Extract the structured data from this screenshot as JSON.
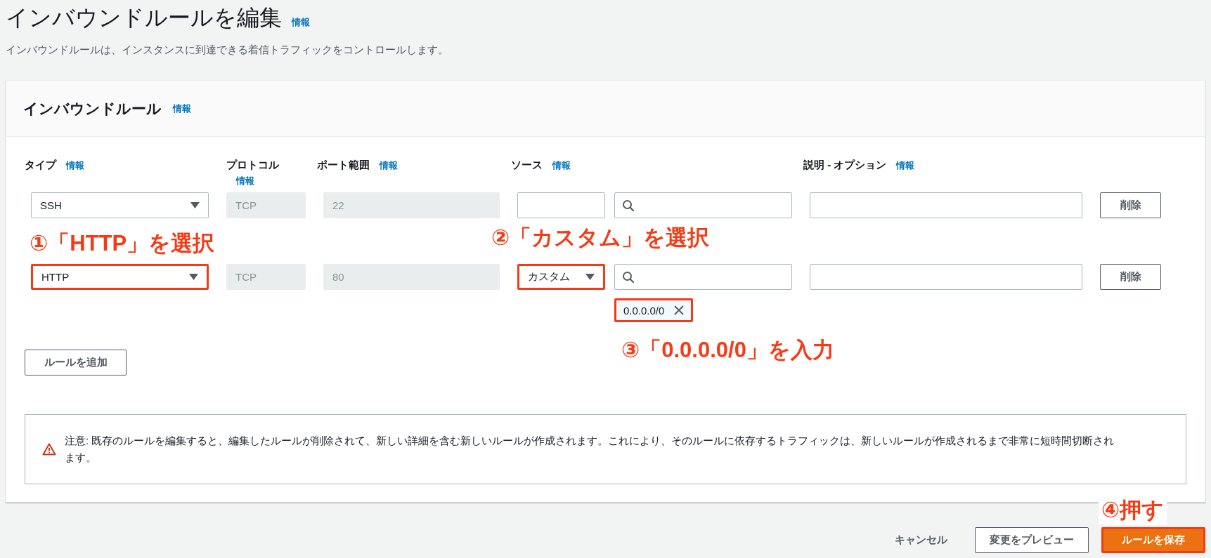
{
  "page": {
    "title": "インバウンドルールを編集",
    "title_info": "情報",
    "description": "インバウンドルールは、インスタンスに到達できる着信トラフィックをコントロールします。"
  },
  "panel": {
    "title": "インバウンドルール",
    "info": "情報",
    "columns": [
      {
        "label": "タイプ",
        "info": "情報",
        "info_below": false
      },
      {
        "label": "プロトコル",
        "info": "情報",
        "info_below": true
      },
      {
        "label": "ポート範囲",
        "info": "情報",
        "info_below": false
      },
      {
        "label": "ソース",
        "info": "情報",
        "info_below": false
      },
      {
        "label": "説明 - オプション",
        "info": "情報",
        "info_below": false
      }
    ],
    "rows": [
      {
        "type": {
          "value": "SSH",
          "highlighted": false
        },
        "protocol": "TCP",
        "port": "22",
        "source_type": {
          "highlighted": false
        },
        "chips": [],
        "delete": "削除"
      },
      {
        "type": {
          "value": "HTTP",
          "highlighted": true
        },
        "protocol": "TCP",
        "port": "80",
        "source_type": {
          "value": "カスタム",
          "highlighted": true
        },
        "chips": [
          {
            "value": "0.0.0.0/0",
            "highlighted": true
          }
        ],
        "delete": "削除"
      }
    ],
    "add_rule": "ルールを追加",
    "warning": "注意: 既存のルールを編集すると、編集したルールが削除されて、新しい詳細を含む新しいルールが作成されます。これにより、そのルールに依存するトラフィックは、新しいルールが作成されるまで非常に短時間切断されます。"
  },
  "footer": [
    {
      "label": "キャンセル",
      "kind": "link",
      "highlighted": false
    },
    {
      "label": "変更をプレビュー",
      "kind": "secondary",
      "highlighted": false
    },
    {
      "label": "ルールを保存",
      "kind": "primary",
      "highlighted": true
    }
  ],
  "annotations": [
    {
      "text": "①「HTTP」を選択"
    },
    {
      "text": "②「カスタム」を選択"
    },
    {
      "text": "③「0.0.0.0/0」を入力"
    },
    {
      "text": "④押す"
    }
  ]
}
